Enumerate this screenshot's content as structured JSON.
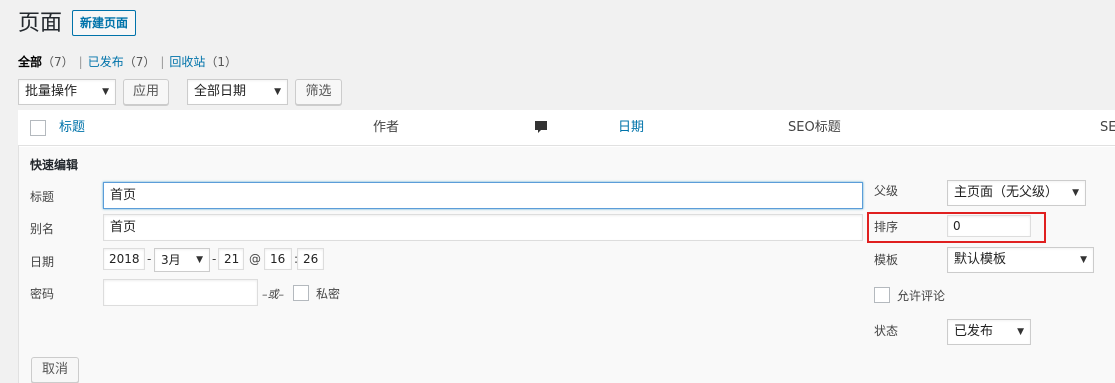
{
  "header": {
    "title": "页面",
    "add_new": "新建页面"
  },
  "filters": {
    "all": "全部",
    "all_count": "（7）",
    "published": "已发布",
    "published_count": "（7）",
    "trash": "回收站",
    "trash_count": "（1）",
    "sep": "|"
  },
  "bulk": {
    "selected": "批量操作",
    "apply": "应用"
  },
  "date_filter": {
    "selected": "全部日期",
    "filter": "筛选"
  },
  "columns": {
    "title": "标题",
    "author": "作者",
    "date": "日期",
    "seo_title": "SEO标题",
    "seo_desc": "SE"
  },
  "quick_edit": {
    "heading": "快速编辑",
    "title_label": "标题",
    "title_value": "首页",
    "slug_label": "别名",
    "slug_value": "首页",
    "date_label": "日期",
    "year": "2018",
    "month": "3月",
    "day": "21",
    "at": "@",
    "hour": "16",
    "minute": "26",
    "dash": "-",
    "colon": ":",
    "password_label": "密码",
    "password_value": "",
    "or": "–或–",
    "private": "私密",
    "parent_label": "父级",
    "parent_value": "主页面（无父级）",
    "order_label": "排序",
    "order_value": "0",
    "template_label": "模板",
    "template_value": "默认模板",
    "comments_label": "允许评论",
    "status_label": "状态",
    "status_value": "已发布",
    "cancel": "取消"
  },
  "colors": {
    "link": "#0073aa",
    "highlight": "#e02020",
    "focus": "#5b9dd9"
  }
}
